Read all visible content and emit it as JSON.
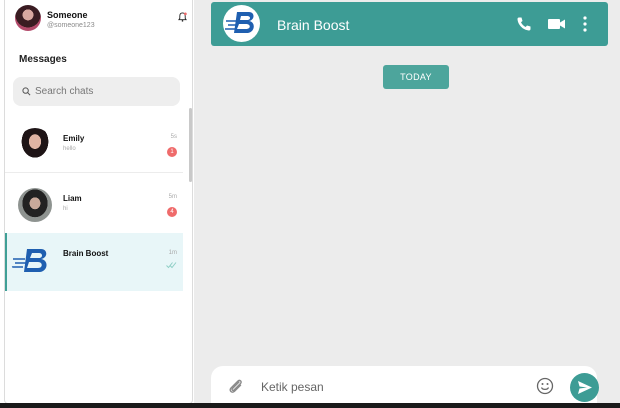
{
  "profile": {
    "name": "Someone",
    "handle": "@someone123"
  },
  "sidebar": {
    "title": "Messages"
  },
  "search": {
    "placeholder": "Search chats"
  },
  "chats": [
    {
      "name": "Emily",
      "preview": "hello",
      "time": "5s",
      "unread": "1"
    },
    {
      "name": "Liam",
      "preview": "hi",
      "time": "5m",
      "unread": "4"
    },
    {
      "name": "Brain Boost",
      "preview": "",
      "time": "1m",
      "unread": ""
    }
  ],
  "header": {
    "title": "Brain Boost"
  },
  "date_chip": "TODAY",
  "composer": {
    "placeholder": "Ketik pesan"
  },
  "colors": {
    "accent": "#3d9c95",
    "badge": "#ef6b6b",
    "active_row": "#e8f6f8",
    "chat_bg": "#ececec"
  },
  "icons": {
    "bell": "bell-icon",
    "search": "search-icon",
    "phone": "phone-icon",
    "video": "video-icon",
    "menu": "kebab-menu-icon",
    "attach": "paperclip-icon",
    "emoji": "emoji-icon",
    "send": "send-icon",
    "read": "double-check-icon"
  }
}
